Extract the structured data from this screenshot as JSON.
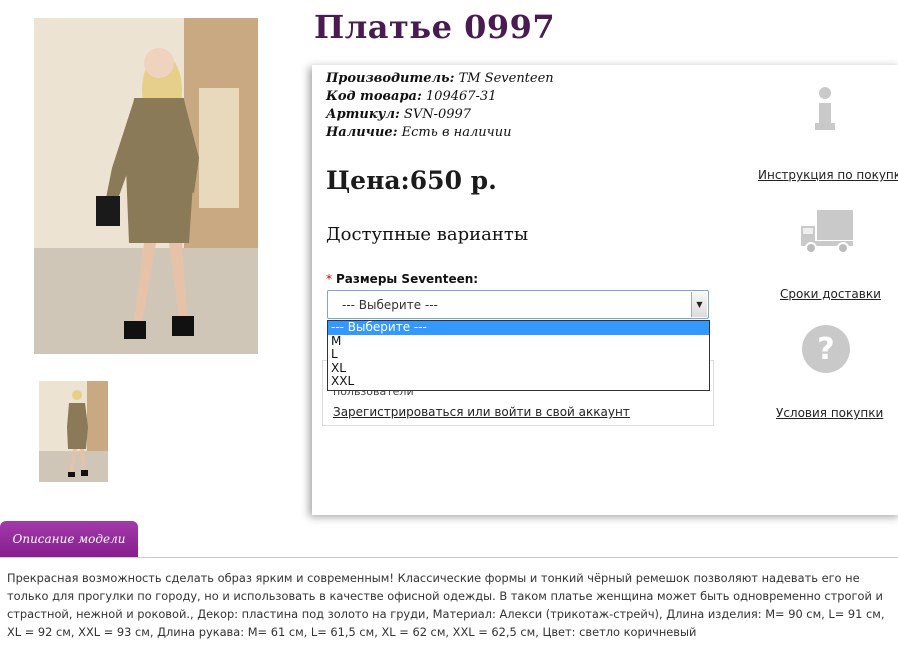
{
  "product": {
    "title": "Платье 0997",
    "manufacturer_label": "Производитель:",
    "manufacturer_value": "TM Seventeen",
    "code_label": "Код товара:",
    "code_value": "109467-31",
    "article_label": "Артикул:",
    "article_value": "SVN-0997",
    "stock_label": "Наличие:",
    "stock_value": "Есть в наличии",
    "price": "Цена:650 р."
  },
  "options": {
    "heading": "Доступные варианты",
    "size_label": "Размеры Seventeen:",
    "required_mark": "*",
    "selected": "--- Выберите ---",
    "dropdown_items": [
      "--- Выберите ---",
      "M",
      "L",
      "XL",
      "XXL"
    ]
  },
  "login": {
    "note": "пользователи",
    "link": "Зарегистрироваться или войти в свой аккаунт"
  },
  "side": {
    "instruction": "Инструкция по покупке",
    "delivery": "Сроки доставки",
    "terms": "Условия покупки"
  },
  "tabs": {
    "description": "Описание модели"
  },
  "description": "Прекрасная возможность сделать образ ярким и современным! Классические формы и тонкий чёрный ремешок позволяют надевать его не только для прогулки по городу, но и использовать в качестве офисной одежды. В таком платье женщина может быть одновременно строгой и страстной, нежной и роковой., Декор: пластина под золото на груди, Материал: Алекси (трикотаж-стрейч), Длина изделия: M= 90 см, L= 91 см, XL = 92 см, XXL = 93 см, Длина рукава: M= 61 см, L= 61,5 см, XL = 62 см, XXL = 62,5 см, Цвет: светло коричневый",
  "colors": {
    "title": "#4a1a52",
    "tab": "#8e2496",
    "dropdown_highlight": "#3399ff",
    "dress": "#8a7a58"
  },
  "icons": [
    "product-photo",
    "info-icon",
    "truck-icon",
    "question-icon",
    "dropdown-arrow-icon"
  ]
}
